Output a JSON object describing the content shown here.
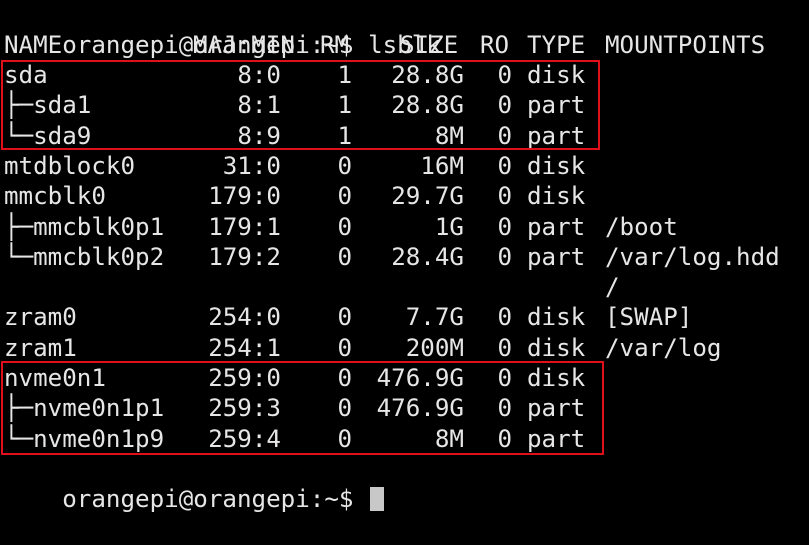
{
  "prompt": {
    "user_host": "orangepi@orangepi:~$",
    "command": "lsblk",
    "final_prompt": "orangepi@orangepi:~$"
  },
  "header": {
    "name": "NAME",
    "majmin": "MAJ:MIN",
    "rm": "RM",
    "size": "SIZE",
    "ro": "RO",
    "type": "TYPE",
    "mountpoints": "MOUNTPOINTS"
  },
  "rows": [
    {
      "name": "sda",
      "majmin": "8:0",
      "rm": "1",
      "size": "28.8G",
      "ro": "0",
      "type": "disk",
      "mount": ""
    },
    {
      "name": "├─sda1",
      "majmin": "8:1",
      "rm": "1",
      "size": "28.8G",
      "ro": "0",
      "type": "part",
      "mount": ""
    },
    {
      "name": "└─sda9",
      "majmin": "8:9",
      "rm": "1",
      "size": "8M",
      "ro": "0",
      "type": "part",
      "mount": ""
    },
    {
      "name": "mtdblock0",
      "majmin": "31:0",
      "rm": "0",
      "size": "16M",
      "ro": "0",
      "type": "disk",
      "mount": ""
    },
    {
      "name": "mmcblk0",
      "majmin": "179:0",
      "rm": "0",
      "size": "29.7G",
      "ro": "0",
      "type": "disk",
      "mount": ""
    },
    {
      "name": "├─mmcblk0p1",
      "majmin": "179:1",
      "rm": "0",
      "size": "1G",
      "ro": "0",
      "type": "part",
      "mount": "/boot"
    },
    {
      "name": "└─mmcblk0p2",
      "majmin": "179:2",
      "rm": "0",
      "size": "28.4G",
      "ro": "0",
      "type": "part",
      "mount": "/var/log.hdd"
    },
    {
      "name": "",
      "majmin": "",
      "rm": "",
      "size": "",
      "ro": "",
      "type": "",
      "mount": "/"
    },
    {
      "name": "zram0",
      "majmin": "254:0",
      "rm": "0",
      "size": "7.7G",
      "ro": "0",
      "type": "disk",
      "mount": "[SWAP]"
    },
    {
      "name": "zram1",
      "majmin": "254:1",
      "rm": "0",
      "size": "200M",
      "ro": "0",
      "type": "disk",
      "mount": "/var/log"
    },
    {
      "name": "nvme0n1",
      "majmin": "259:0",
      "rm": "0",
      "size": "476.9G",
      "ro": "0",
      "type": "disk",
      "mount": ""
    },
    {
      "name": "├─nvme0n1p1",
      "majmin": "259:3",
      "rm": "0",
      "size": "476.9G",
      "ro": "0",
      "type": "part",
      "mount": ""
    },
    {
      "name": "└─nvme0n1p9",
      "majmin": "259:4",
      "rm": "0",
      "size": "8M",
      "ro": "0",
      "type": "part",
      "mount": ""
    }
  ],
  "colors": {
    "background": "#000000",
    "text": "#e6e6e6",
    "highlight_box": "#e0101a",
    "cursor": "#c8c8c8"
  }
}
